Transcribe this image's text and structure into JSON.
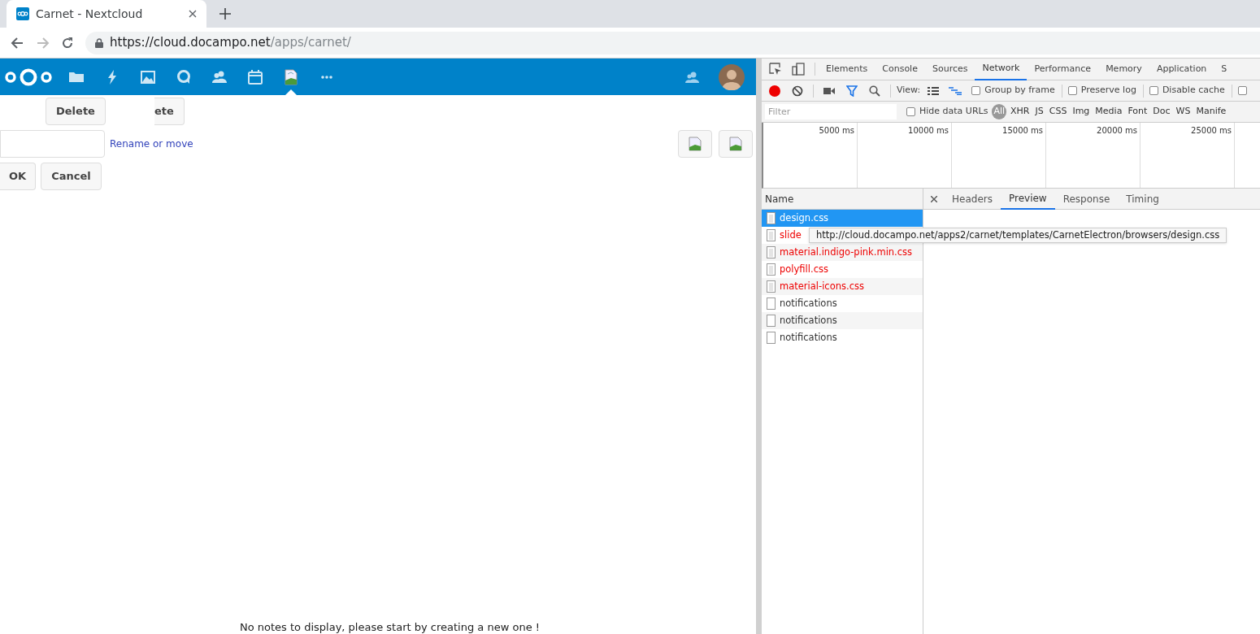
{
  "browser": {
    "tabs": [
      {
        "title": "Carnet - Nextcloud",
        "selected": true
      }
    ],
    "url_host": "https://cloud.docampo.net",
    "url_path": "/apps/carnet/"
  },
  "app_bar": {
    "apps": [
      {
        "kind": "folder",
        "selected": false
      },
      {
        "kind": "bolt",
        "selected": false
      },
      {
        "kind": "image",
        "selected": false
      },
      {
        "kind": "talk",
        "selected": false
      },
      {
        "kind": "contacts",
        "selected": false
      },
      {
        "kind": "calendar",
        "selected": false
      },
      {
        "kind": "broken",
        "selected": true
      },
      {
        "kind": "more",
        "selected": false
      }
    ]
  },
  "page": {
    "buttons_row": [
      "Delete",
      "ete"
    ],
    "rename_link": "Rename or move",
    "dialog_buttons": [
      "OK",
      "Cancel"
    ],
    "empty_message": "No notes to display, please start by creating a new one !"
  },
  "devtools": {
    "tabs": [
      {
        "label": "Elements",
        "selected": false
      },
      {
        "label": "Console",
        "selected": false
      },
      {
        "label": "Sources",
        "selected": false
      },
      {
        "label": "Network",
        "selected": true
      },
      {
        "label": "Performance",
        "selected": false
      },
      {
        "label": "Memory",
        "selected": false
      },
      {
        "label": "Application",
        "selected": false
      },
      {
        "label": "S",
        "selected": false
      }
    ],
    "view_label": "View:",
    "options": [
      {
        "label": "Group by frame",
        "checked": false
      },
      {
        "label": "Preserve log",
        "checked": false
      },
      {
        "label": "Disable cache",
        "checked": false
      },
      {
        "checked": false
      }
    ],
    "filter_placeholder": "Filter",
    "hide_data_urls": {
      "label": "Hide data URLs",
      "checked": false
    },
    "types": [
      {
        "label": "All",
        "selected": true
      },
      {
        "label": "XHR",
        "selected": false
      },
      {
        "label": "JS",
        "selected": false
      },
      {
        "label": "CSS",
        "selected": false
      },
      {
        "label": "Img",
        "selected": false
      },
      {
        "label": "Media",
        "selected": false
      },
      {
        "label": "Font",
        "selected": false
      },
      {
        "label": "Doc",
        "selected": false
      },
      {
        "label": "WS",
        "selected": false
      },
      {
        "label": "Manife",
        "selected": false
      }
    ],
    "timeline_ticks": [
      "5000 ms",
      "10000 ms",
      "15000 ms",
      "20000 ms",
      "25000 ms"
    ],
    "name_header": "Name",
    "requests": [
      {
        "name": "design.css",
        "selected": true,
        "failed": false,
        "kind": "css"
      },
      {
        "name": "slide",
        "selected": false,
        "failed": true,
        "kind": "css"
      },
      {
        "name": "material.indigo-pink.min.css",
        "selected": false,
        "failed": true,
        "kind": "css"
      },
      {
        "name": "polyfill.css",
        "selected": false,
        "failed": true,
        "kind": "css"
      },
      {
        "name": "material-icons.css",
        "selected": false,
        "failed": true,
        "kind": "css"
      },
      {
        "name": "notifications",
        "selected": false,
        "failed": false,
        "kind": "blank"
      },
      {
        "name": "notifications",
        "selected": false,
        "failed": false,
        "kind": "blank"
      },
      {
        "name": "notifications",
        "selected": false,
        "failed": false,
        "kind": "blank"
      }
    ],
    "detail_tabs": [
      {
        "label": "Headers",
        "selected": false
      },
      {
        "label": "Preview",
        "selected": true
      },
      {
        "label": "Response",
        "selected": false
      },
      {
        "label": "Timing",
        "selected": false
      }
    ],
    "tooltip": "http://cloud.docampo.net/apps2/carnet/templates/CarnetElectron/browsers/design.css"
  }
}
